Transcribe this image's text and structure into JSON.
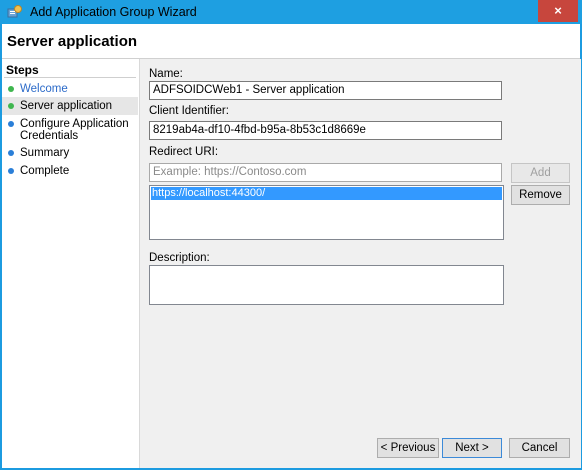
{
  "window": {
    "title": "Add Application Group Wizard",
    "close_label": "×"
  },
  "header": {
    "title": "Server application"
  },
  "sidebar": {
    "title": "Steps",
    "items": [
      {
        "label": "Welcome",
        "color": "#2c6bc9",
        "dot": "#3fb64f"
      },
      {
        "label": "Server application",
        "color": "#000000",
        "dot": "#3fb64f"
      },
      {
        "label": "Configure Application",
        "label2": "Credentials",
        "color": "#000000",
        "dot": "#2a7fd8"
      },
      {
        "label": "Summary",
        "color": "#000000",
        "dot": "#2a7fd8"
      },
      {
        "label": "Complete",
        "color": "#000000",
        "dot": "#2a7fd8"
      }
    ]
  },
  "form": {
    "name_label": "Name:",
    "name_value": "ADFSOIDCWeb1 - Server application",
    "client_id_label": "Client Identifier:",
    "client_id_value": "8219ab4a-df10-4fbd-b95a-8b53c1d8669e",
    "redirect_label": "Redirect URI:",
    "redirect_placeholder": "Example: https://Contoso.com",
    "redirect_list": [
      "https://localhost:44300/"
    ],
    "add_label": "Add",
    "remove_label": "Remove",
    "description_label": "Description:",
    "description_value": ""
  },
  "footer": {
    "previous_label": "< Previous",
    "next_label": "Next >",
    "cancel_label": "Cancel"
  }
}
